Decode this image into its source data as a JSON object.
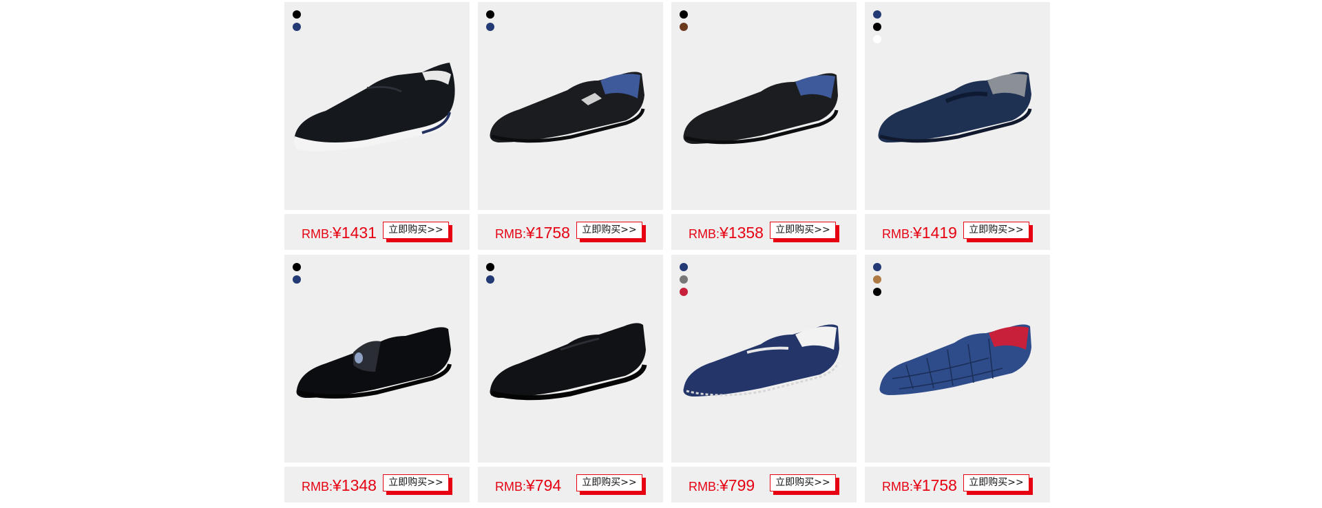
{
  "products": [
    {
      "price_prefix": "RMB:",
      "price": "¥1431",
      "buy_label": "立即购买>>",
      "colors": [
        "#000000",
        "#243a75"
      ],
      "shoe": "slip-on-sneaker"
    },
    {
      "price_prefix": "RMB:",
      "price": "¥1758",
      "buy_label": "立即购买>>",
      "colors": [
        "#000000",
        "#243a75"
      ],
      "shoe": "bit-loafer"
    },
    {
      "price_prefix": "RMB:",
      "price": "¥1358",
      "buy_label": "立即购买>>",
      "colors": [
        "#000000",
        "#6b3a1e"
      ],
      "shoe": "loafer"
    },
    {
      "price_prefix": "RMB:",
      "price": "¥1419",
      "buy_label": "立即购买>>",
      "colors": [
        "#243a75",
        "#000000",
        "#ffffff"
      ],
      "shoe": "bit-loafer-navy"
    },
    {
      "price_prefix": "RMB:",
      "price": "¥1348",
      "buy_label": "立即购买>>",
      "colors": [
        "#000000",
        "#243a75"
      ],
      "shoe": "patent-loafer"
    },
    {
      "price_prefix": "RMB:",
      "price": "¥794",
      "buy_label": "立即购买>>",
      "colors": [
        "#000000",
        "#243a75"
      ],
      "shoe": "plain-slip-on"
    },
    {
      "price_prefix": "RMB:",
      "price": "¥799",
      "buy_label": "立即购买>>",
      "colors": [
        "#243a75",
        "#777777",
        "#c8203a"
      ],
      "shoe": "suede-driver"
    },
    {
      "price_prefix": "RMB:",
      "price": "¥1758",
      "buy_label": "立即购买>>",
      "colors": [
        "#243a75",
        "#b07a45",
        "#000000"
      ],
      "shoe": "croc-driver"
    }
  ],
  "theme": {
    "price_color": "#e60012",
    "card_bg": "#efefef"
  }
}
